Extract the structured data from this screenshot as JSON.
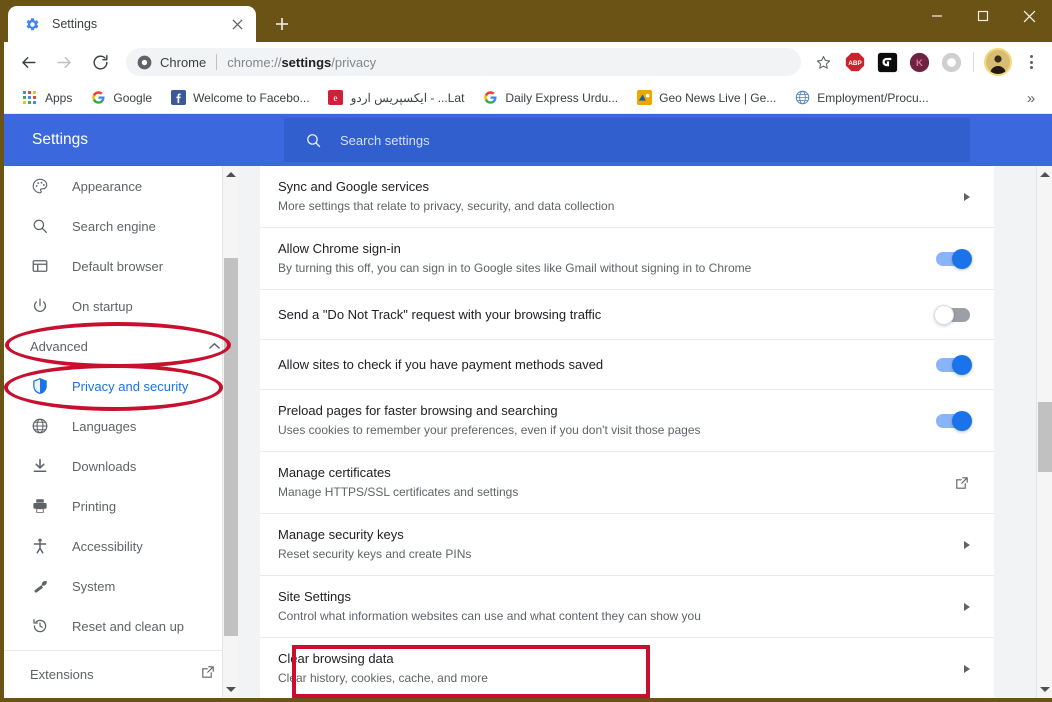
{
  "window": {
    "titlebar_color": "#6b5315",
    "controls": {
      "minimize": "—",
      "maximize": "□",
      "close": "✕"
    }
  },
  "tabs": [
    {
      "title": "Settings",
      "favicon": "gear-icon",
      "active": true,
      "close_label": "✕"
    }
  ],
  "newtab": {
    "label": "+"
  },
  "toolbar": {
    "back": "←",
    "forward": "→",
    "reload": "⟳",
    "omnibox": {
      "scheme_label": "Chrome",
      "url_prefix": "chrome://",
      "url_bold": "settings",
      "url_suffix": "/privacy",
      "full_url": "chrome://settings/privacy",
      "chrome_icon": "chrome-logo-icon"
    },
    "star": "☆",
    "extensions": [
      {
        "name": "adblock-plus-icon",
        "label": "ABP",
        "color": "#c9232d"
      },
      {
        "name": "extension-black-icon",
        "label": "",
        "color": "#000000"
      },
      {
        "name": "kaspersky-icon",
        "label": "K",
        "color": "#8c2a4e"
      },
      {
        "name": "extension-gray-icon",
        "label": "",
        "color": "#c4c4c4"
      }
    ],
    "avatar": "profile-avatar",
    "menu": "three-dot-menu"
  },
  "bookmarks": {
    "items": [
      {
        "label": "Apps",
        "icon": "apps-grid-icon"
      },
      {
        "label": "Google",
        "icon": "google-g-icon"
      },
      {
        "label": "Welcome to Facebo...",
        "icon": "facebook-icon"
      },
      {
        "label": "ایکسپریس اردو - ...Lat",
        "icon": "express-e-icon"
      },
      {
        "label": "Daily Express Urdu...",
        "icon": "google-g-icon"
      },
      {
        "label": "Geo News Live | Ge...",
        "icon": "geo-news-icon"
      },
      {
        "label": "Employment/Procu...",
        "icon": "globe-blue-icon"
      }
    ],
    "overflow": "»"
  },
  "settings_header": {
    "title": "Settings",
    "accent_color": "#3b69dd",
    "search": {
      "placeholder": "Search settings",
      "value": "",
      "icon": "search-icon"
    }
  },
  "sidebar": {
    "items": [
      {
        "label": "Appearance",
        "icon": "palette-icon",
        "selected": false,
        "type": "nav"
      },
      {
        "label": "Search engine",
        "icon": "magnifier-icon",
        "selected": false,
        "type": "nav"
      },
      {
        "label": "Default browser",
        "icon": "browser-window-icon",
        "selected": false,
        "type": "nav"
      },
      {
        "label": "On startup",
        "icon": "power-icon",
        "selected": false,
        "type": "nav"
      },
      {
        "label": "Advanced",
        "icon": "",
        "selected": false,
        "type": "expander",
        "expanded": true
      },
      {
        "label": "Privacy and security",
        "icon": "shield-icon",
        "selected": true,
        "type": "nav"
      },
      {
        "label": "Languages",
        "icon": "globe-icon",
        "selected": false,
        "type": "nav"
      },
      {
        "label": "Downloads",
        "icon": "download-icon",
        "selected": false,
        "type": "nav"
      },
      {
        "label": "Printing",
        "icon": "printer-icon",
        "selected": false,
        "type": "nav"
      },
      {
        "label": "Accessibility",
        "icon": "accessibility-icon",
        "selected": false,
        "type": "nav"
      },
      {
        "label": "System",
        "icon": "wrench-icon",
        "selected": false,
        "type": "nav"
      },
      {
        "label": "Reset and clean up",
        "icon": "history-restore-icon",
        "selected": false,
        "type": "nav"
      }
    ],
    "footer": {
      "label": "Extensions",
      "icon": "external-link-icon"
    }
  },
  "main": {
    "rows": [
      {
        "title": "Sync and Google services",
        "subtitle": "More settings that relate to privacy, security, and data collection",
        "control": "arrow"
      },
      {
        "title": "Allow Chrome sign-in",
        "subtitle": "By turning this off, you can sign in to Google sites like Gmail without signing in to Chrome",
        "control": "toggle",
        "toggle_state": "on"
      },
      {
        "title": "Send a \"Do Not Track\" request with your browsing traffic",
        "subtitle": "",
        "control": "toggle",
        "toggle_state": "off"
      },
      {
        "title": "Allow sites to check if you have payment methods saved",
        "subtitle": "",
        "control": "toggle",
        "toggle_state": "on"
      },
      {
        "title": "Preload pages for faster browsing and searching",
        "subtitle": "Uses cookies to remember your preferences, even if you don't visit those pages",
        "control": "toggle",
        "toggle_state": "on"
      },
      {
        "title": "Manage certificates",
        "subtitle": "Manage HTTPS/SSL certificates and settings",
        "control": "external"
      },
      {
        "title": "Manage security keys",
        "subtitle": "Reset security keys and create PINs",
        "control": "arrow"
      },
      {
        "title": "Site Settings",
        "subtitle": "Control what information websites can use and what content they can show you",
        "control": "arrow"
      },
      {
        "title": "Clear browsing data",
        "subtitle": "Clear history, cookies, cache, and more",
        "control": "arrow",
        "highlighted": true
      }
    ]
  },
  "annotations": {
    "color": "#c8102e",
    "shapes": [
      {
        "name": "advanced-highlight-ellipse",
        "type": "ellipse"
      },
      {
        "name": "privacy-and-security-highlight-ellipse",
        "type": "ellipse"
      },
      {
        "name": "clear-browsing-data-highlight-rect",
        "type": "rect"
      }
    ]
  },
  "scrollbars": {
    "sidebar": {
      "thumb_top_pct": 15,
      "thumb_height_pct": 76
    },
    "content": {
      "thumb_top_pct": 44,
      "thumb_height_pct": 14
    }
  }
}
